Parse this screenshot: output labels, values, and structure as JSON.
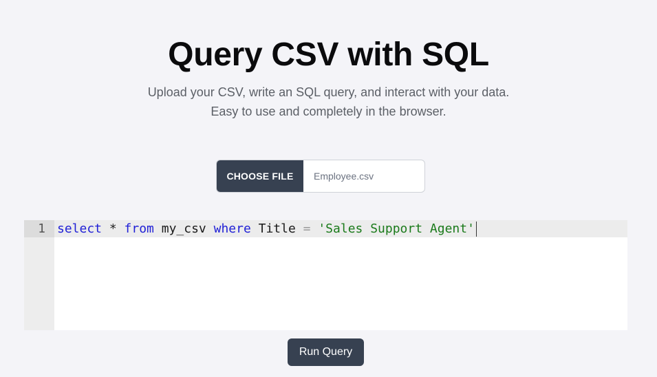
{
  "header": {
    "title": "Query CSV with SQL",
    "subtitle_line1": "Upload your CSV, write an SQL query, and interact with your data.",
    "subtitle_line2": "Easy to use and completely in the browser."
  },
  "file_picker": {
    "button_label": "CHOOSE FILE",
    "file_name": "Employee.csv"
  },
  "editor": {
    "line_number": "1",
    "tokens": {
      "select": "select",
      "star": " * ",
      "from": "from",
      "table": " my_csv ",
      "where": "where",
      "column": " Title ",
      "equals": "=",
      "space": " ",
      "value": "'Sales Support Agent'"
    }
  },
  "actions": {
    "run_label": "Run Query"
  },
  "colors": {
    "button_bg": "#374151",
    "page_bg": "#f4f4f8",
    "keyword": "#1f1fd6",
    "string": "#1a7a1a"
  }
}
